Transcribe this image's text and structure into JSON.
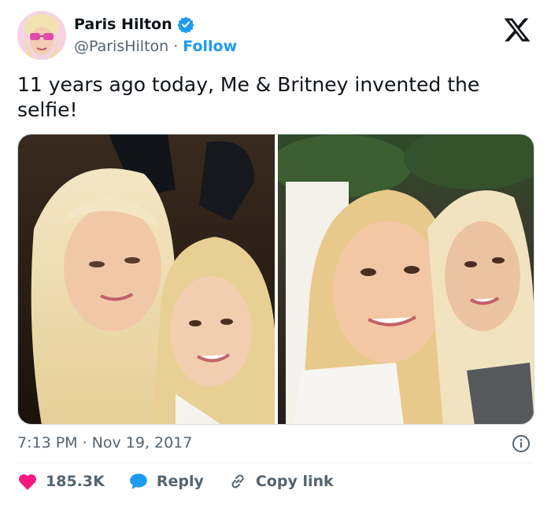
{
  "author": {
    "name": "Paris Hilton",
    "handle": "@ParisHilton",
    "separator": "·",
    "follow_label": "Follow",
    "verified_color": "#1d9bf0"
  },
  "tweet": {
    "text": "11 years ago today, Me & Britney invented the selfie!"
  },
  "meta": {
    "time": "7:13 PM",
    "separator": "·",
    "date": "Nov 19, 2017"
  },
  "actions": {
    "like_count": "185.3K",
    "reply_label": "Reply",
    "copy_label": "Copy link"
  },
  "colors": {
    "accent": "#1d9bf0",
    "like": "#f91880",
    "muted": "#536471"
  },
  "icons": [
    "x-logo-icon",
    "verified-badge-icon",
    "info-icon",
    "heart-icon",
    "reply-bubble-icon",
    "link-icon"
  ]
}
